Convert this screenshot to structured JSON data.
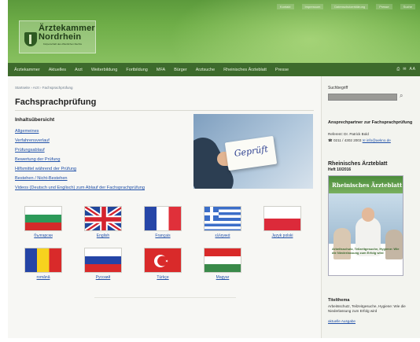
{
  "header": {
    "top_links": [
      "Kontakt",
      "Impressum",
      "Datenschutzerklärung",
      "Presse",
      "Suche"
    ],
    "logo_line1": "Ärztekammer",
    "logo_line2": "Nordrhein",
    "logo_sub": "Körperschaft des öffentlichen Rechts"
  },
  "nav": {
    "items": [
      "Ärztekammer",
      "Aktuelles",
      "Arzt",
      "Weiterbildung",
      "Fortbildung",
      "MFA",
      "Bürger",
      "Arztsuche",
      "Rheinisches Ärzteblatt",
      "Presse"
    ],
    "tools": [
      "⎙",
      "✉",
      "A A"
    ]
  },
  "main": {
    "breadcrumb": "Startseite › Arzt › Fachsprachprüfung",
    "title": "Fachsprachprüfung",
    "toc_heading": "Inhaltsübersicht",
    "toc": [
      "Allgemeines",
      "Verfahrensverlauf",
      "Prüfungsablauf",
      "Bewertung der Prüfung",
      "Hilfsmittel während der Prüfung",
      "Bestehen / Nicht-Bestehen",
      "Videos (Deutsch und Englisch) zum Ablauf der Fachsprachprüfung"
    ],
    "hero_card_text": "Geprüft"
  },
  "flags": [
    {
      "label": "български",
      "icon": "bulgaria-flag"
    },
    {
      "label": "English",
      "icon": "uk-flag"
    },
    {
      "label": "Français",
      "icon": "france-flag"
    },
    {
      "label": "ελληνικά",
      "icon": "greece-flag"
    },
    {
      "label": "Język polski",
      "icon": "poland-flag"
    },
    {
      "label": "română",
      "icon": "romania-flag"
    },
    {
      "label": "Русский",
      "icon": "russia-flag"
    },
    {
      "label": "Türkçe",
      "icon": "turkey-flag"
    },
    {
      "label": "Magyar",
      "icon": "hungary-flag"
    }
  ],
  "sidebar": {
    "search_label": "Suchbegriff",
    "contact_heading": "Ansprechpartner zur Fachsprachprüfung",
    "contact_ref": "Referent: Dr. Patrick Bold",
    "contact_phone": "☎ 0211 / 4302 2003",
    "contact_email": "✉ info@aekno.de",
    "magazine_heading": "Rheinisches Ärzteblatt",
    "magazine_issue": "Heft 10/2016",
    "magazine_cover_title": "Rheinisches Ärzteblatt",
    "magazine_caption": "Arbeitsschutz, Teilzeitgesuche, Hygiene: Wie die Niederlassung zum Erfolg wird",
    "themes_heading": "Titelthema",
    "themes_text": "Arbeitsschutz, Teilzeitgesuche, Hygiene: Wie die Niederlassung zum Erfolg wird",
    "themes_link": "aktuelle Ausgabe"
  }
}
